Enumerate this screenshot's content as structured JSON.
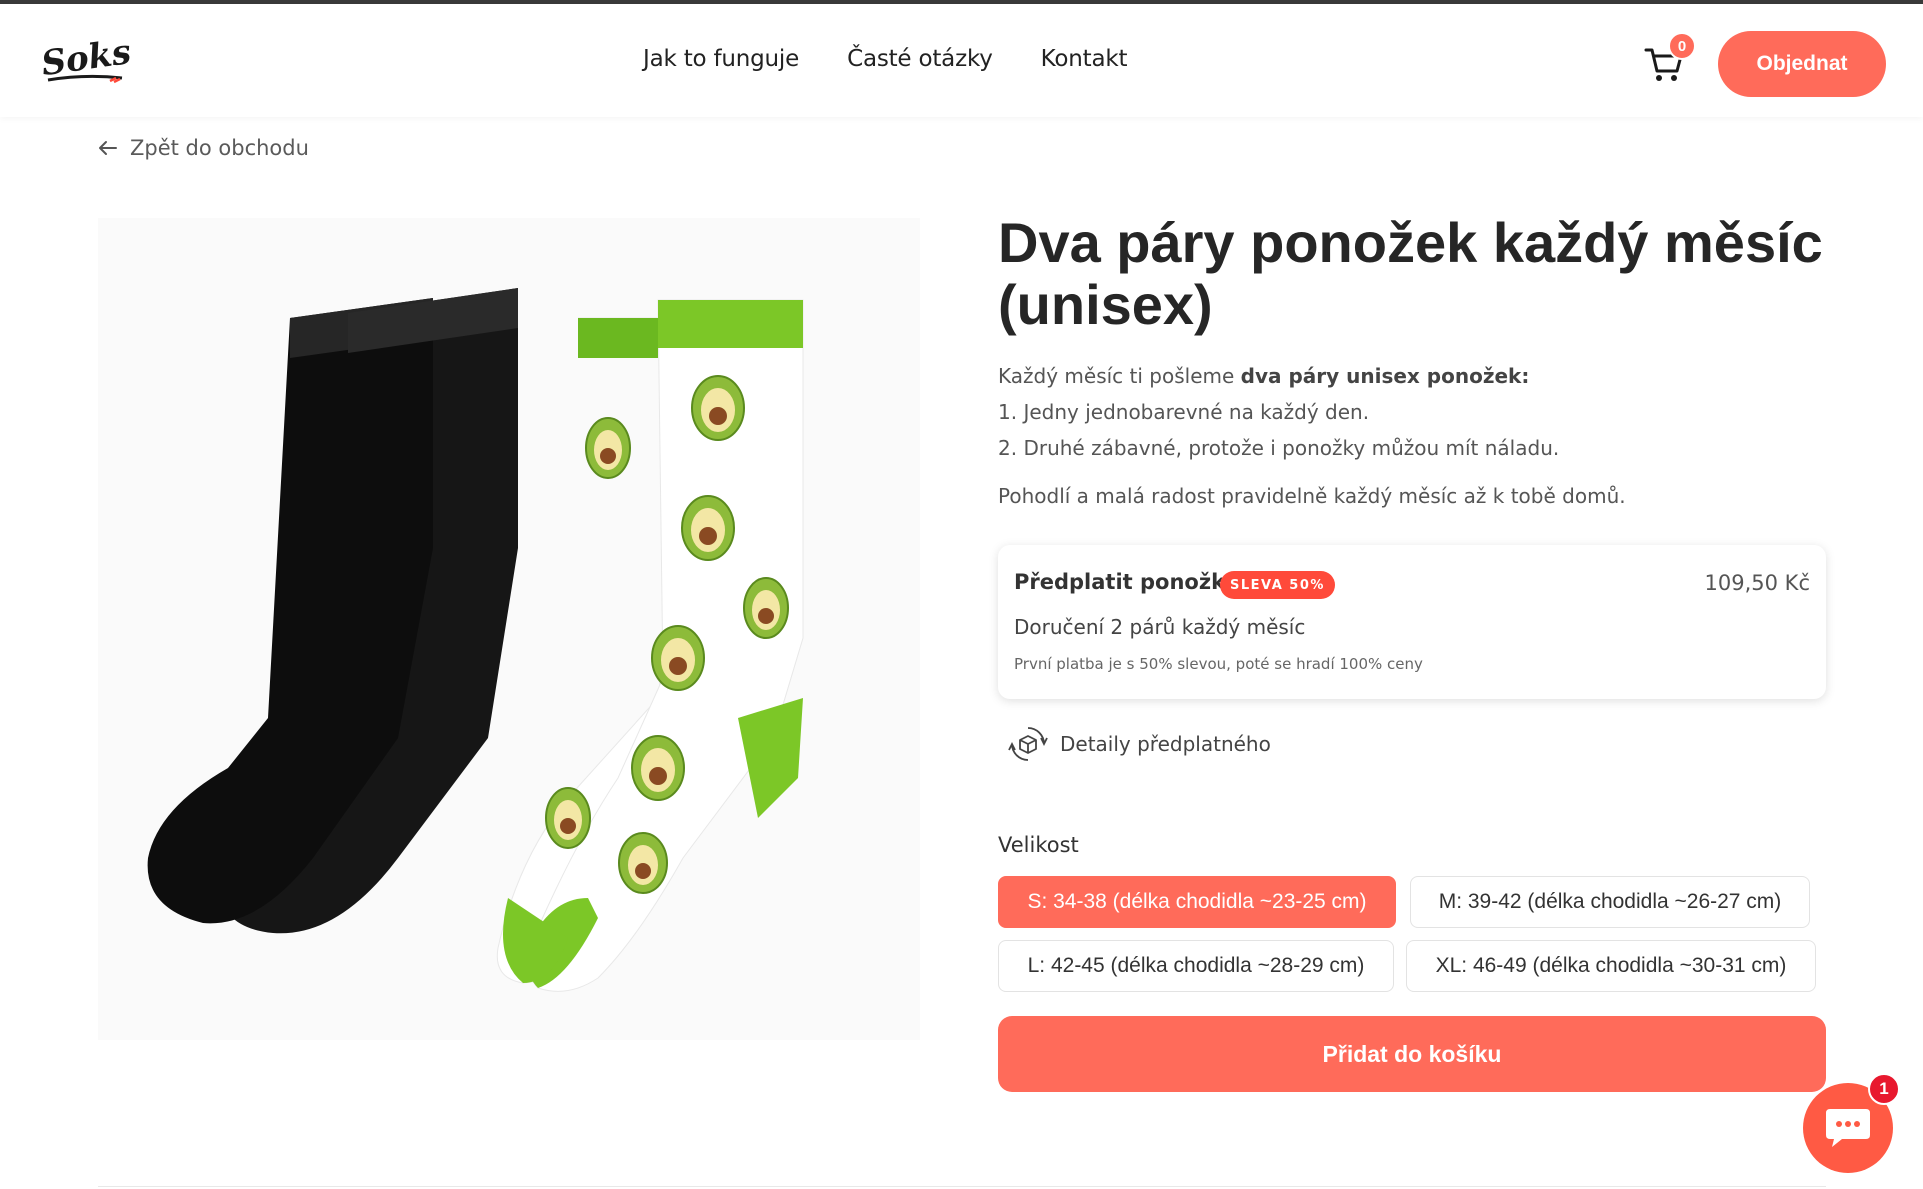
{
  "brand": {
    "logo_text": "Soks",
    "accent_color": "#ff6b5a"
  },
  "nav": {
    "items": [
      "Jak to funguje",
      "Časté otázky",
      "Kontakt"
    ]
  },
  "header": {
    "cart_count": "0",
    "order_button": "Objednat"
  },
  "back_link": "Zpět do obchodu",
  "product": {
    "title": "Dva páry ponožek každý měsíc (unisex)",
    "desc_intro": "Každý měsíc ti pošleme ",
    "desc_bold": "dva páry unisex ponožek:",
    "desc_line1": "1. Jedny jednobarevné na každý den.",
    "desc_line2": "2. Druhé zábavné, protože i ponožky můžou mít náladu.",
    "desc_outro": "Pohodlí a malá radost pravidelně každý měsíc až k tobě domů."
  },
  "subscription": {
    "title": "Předplatit ponožky",
    "badge": "SLEVA 50%",
    "price": "109,50 Kč",
    "delivery": "Doručení 2 párů každý měsíc",
    "note": "První platba je s 50% slevou, poté se hradí 100% ceny"
  },
  "details_link": "Detaily předplatného",
  "sizes": {
    "label": "Velikost",
    "options": [
      "S: 34-38 (délka chodidla ~23-25 cm)",
      "M: 39-42 (délka chodidla ~26-27 cm)",
      "L: 42-45 (délka chodidla ~28-29 cm)",
      "XL: 46-49 (délka chodidla ~30-31 cm)"
    ],
    "selected": "S: 34-38 (délka chodidla ~23-25 cm)"
  },
  "add_to_cart": "Přidat do košíku",
  "chat": {
    "unread": "1"
  }
}
